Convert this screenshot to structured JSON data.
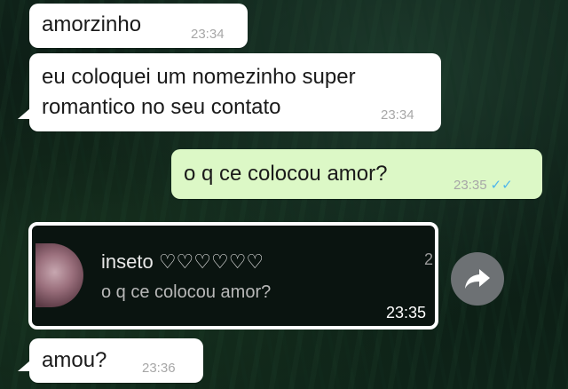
{
  "messages": [
    {
      "text": "amorzinho",
      "time": "23:34"
    },
    {
      "line1": "eu coloquei um nomezinho super",
      "line2": "romantico no seu contato",
      "time": "23:34"
    },
    {
      "text": "o q ce colocou amor?",
      "time": "23:35",
      "ticks": "✓✓"
    },
    {
      "text": "amou?",
      "time": "23:36"
    }
  ],
  "quoted": {
    "name": "inseto ♡♡♡♡♡♡",
    "text": "o q ce colocou amor?",
    "time": "23:35",
    "edge_digit": "2"
  },
  "icons": {
    "forward": "forward-share-icon",
    "avatar": "contact-avatar"
  },
  "colors": {
    "incoming": "#ffffff",
    "outgoing": "#dcf8c6",
    "ticks": "#4fb6ec",
    "forward_button": "#6d7174"
  }
}
